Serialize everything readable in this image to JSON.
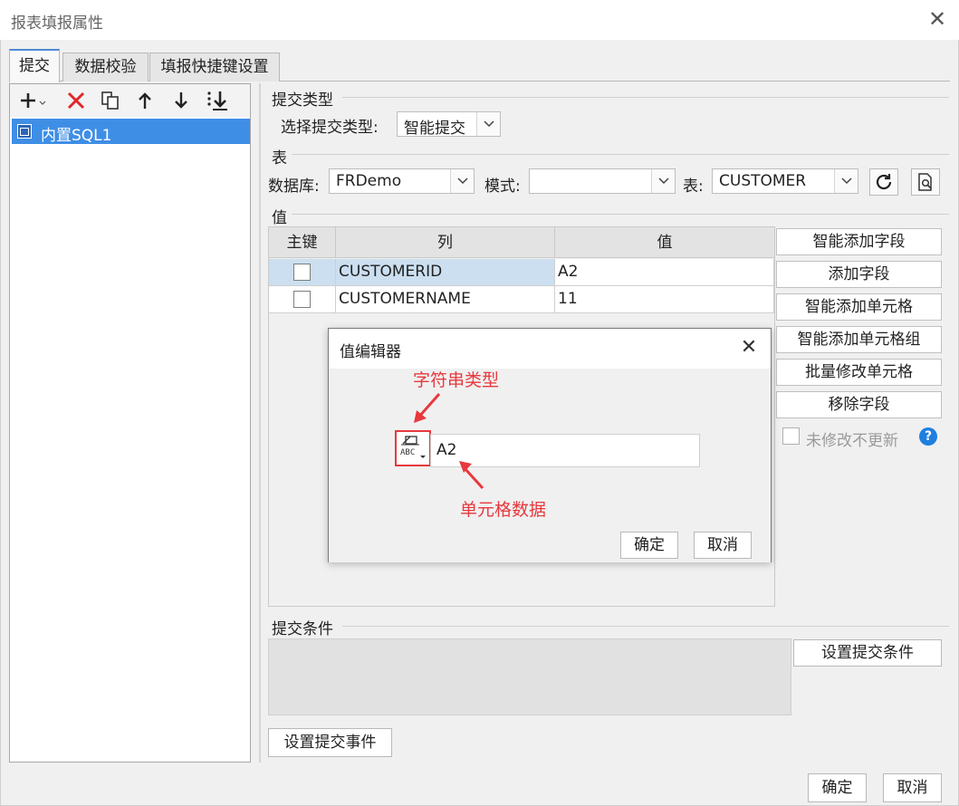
{
  "window": {
    "title": "报表填报属性"
  },
  "tabs": [
    {
      "label": "提交"
    },
    {
      "label": "数据校验"
    },
    {
      "label": "填报快捷键设置"
    }
  ],
  "tree": {
    "items": [
      {
        "label": "内置SQL1"
      }
    ]
  },
  "submit_type": {
    "section": "提交类型",
    "select_label": "选择提交类型:",
    "selected": "智能提交"
  },
  "table_section": {
    "section": "表",
    "db_label": "数据库:",
    "db_value": "FRDemo",
    "mode_label": "模式:",
    "mode_value": "",
    "table_label": "表:",
    "table_value": "CUSTOMER"
  },
  "values": {
    "section": "值",
    "headers": [
      "主键",
      "列",
      "值"
    ],
    "rows": [
      {
        "column": "CUSTOMERID",
        "value": "A2"
      },
      {
        "column": "CUSTOMERNAME",
        "value": "11"
      }
    ]
  },
  "side_buttons": [
    "智能添加字段",
    "添加字段",
    "智能添加单元格",
    "智能添加单元格组",
    "批量修改单元格",
    "移除字段"
  ],
  "no_update_label": "未修改不更新",
  "dialog": {
    "title": "值编辑器",
    "annotation_type": "字符串类型",
    "annotation_data": "单元格数据",
    "input_value": "A2",
    "ok": "确定",
    "cancel": "取消"
  },
  "condition": {
    "section": "提交条件",
    "button": "设置提交条件"
  },
  "event_button": "设置提交事件",
  "footer": {
    "ok": "确定",
    "cancel": "取消"
  },
  "colors": {
    "accent": "#3f8ee6",
    "annotation": "#e8383d"
  }
}
